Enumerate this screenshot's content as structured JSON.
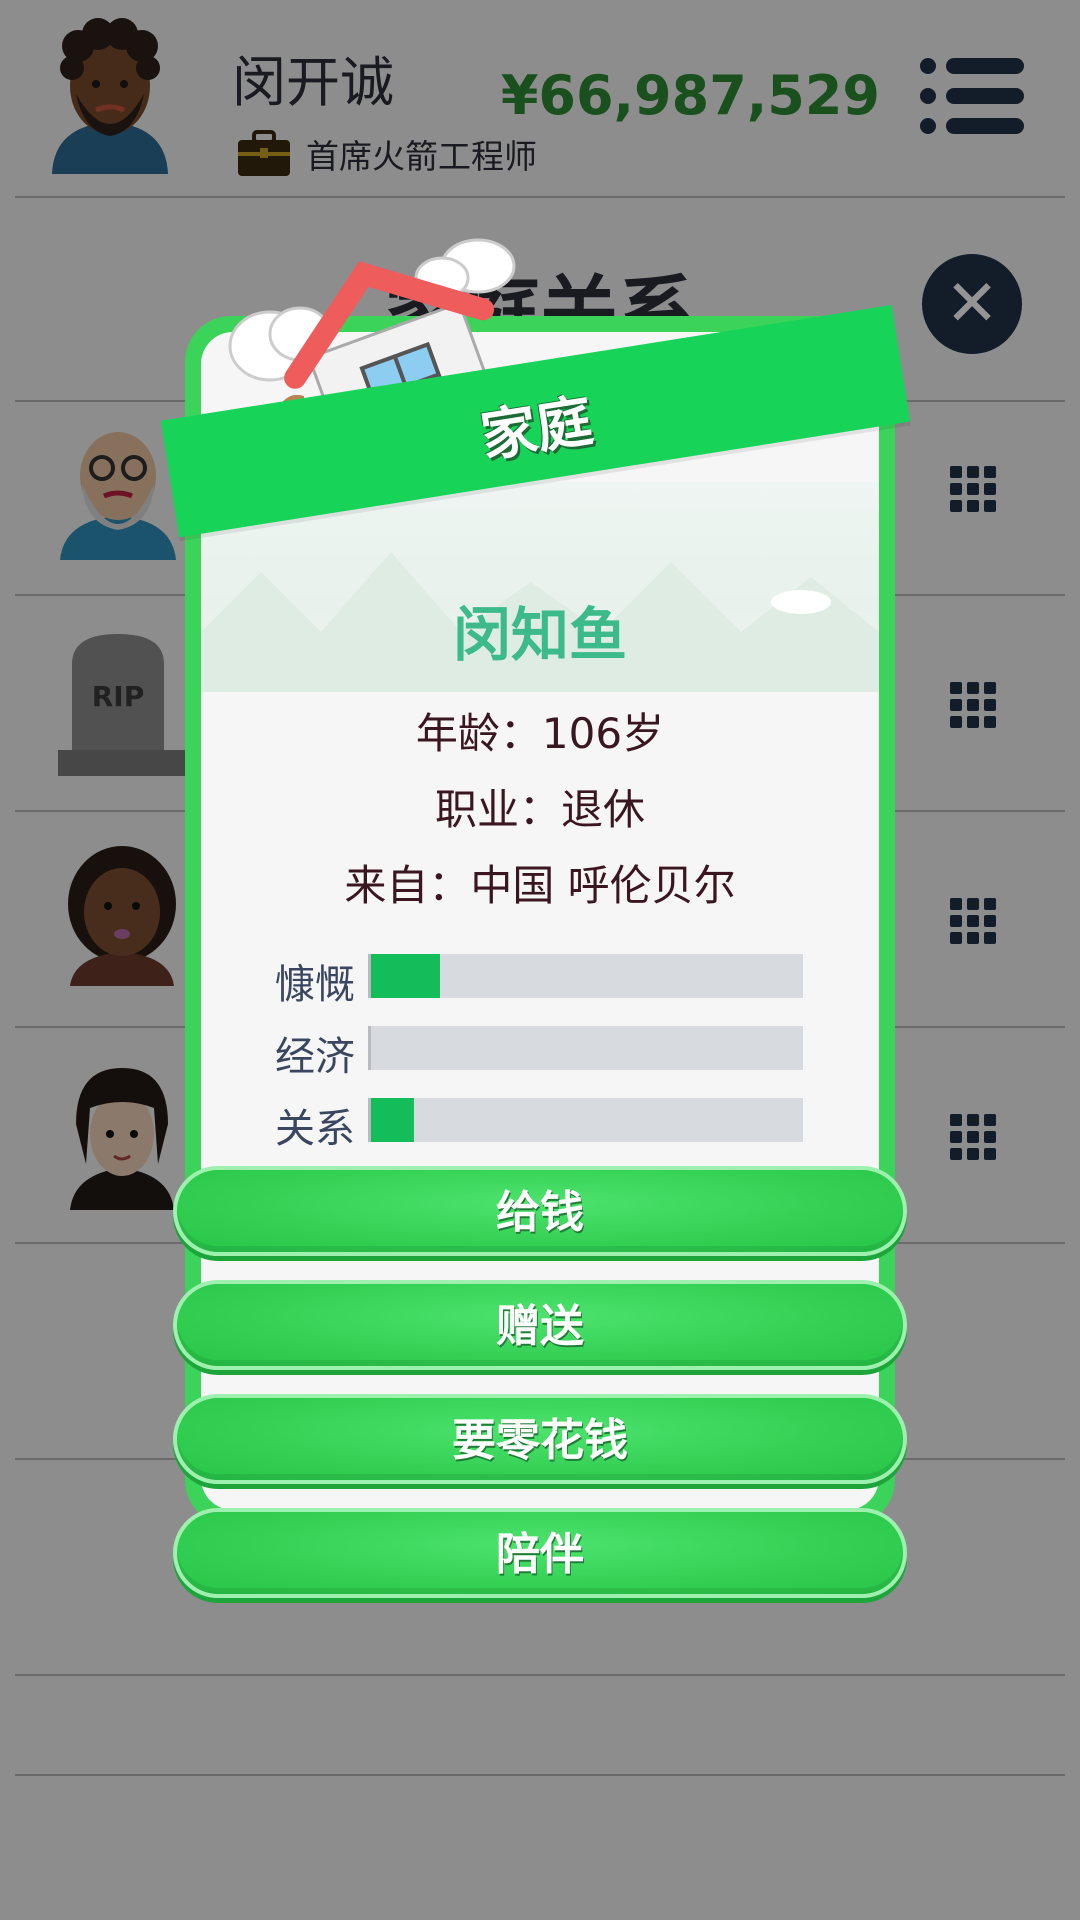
{
  "header": {
    "player_name": "闵开诚",
    "job_icon": "briefcase-icon",
    "job_title": "首席火箭工程师",
    "money": "¥66,987,529",
    "menu_icon": "menu-icon"
  },
  "section": {
    "title": "家庭关系",
    "close_icon": "close-icon"
  },
  "family_list": [
    {
      "avatar": "grandfather-avatar",
      "status": "alive"
    },
    {
      "avatar": "tombstone-avatar",
      "status": "deceased",
      "tomb_text": "RIP"
    },
    {
      "avatar": "mother-avatar",
      "status": "alive"
    },
    {
      "avatar": "sibling-avatar",
      "status": "alive"
    }
  ],
  "modal": {
    "banner": "家庭",
    "name": "闵知鱼",
    "age_line": "年龄：106岁",
    "job_line": "职业：退休",
    "origin_line": "来自：中国 呼伦贝尔",
    "stats": [
      {
        "label": "慷慨",
        "value": 0.16
      },
      {
        "label": "经济",
        "value": 0.0
      },
      {
        "label": "关系",
        "value": 0.1
      }
    ],
    "actions": [
      {
        "label": "给钱"
      },
      {
        "label": "赠送"
      },
      {
        "label": "要零花钱"
      },
      {
        "label": "陪伴"
      }
    ]
  },
  "colors": {
    "accent_green": "#3cd35a",
    "money_green": "#2c8a32",
    "navy": "#1f3247",
    "name_teal": "#3cba8a"
  }
}
